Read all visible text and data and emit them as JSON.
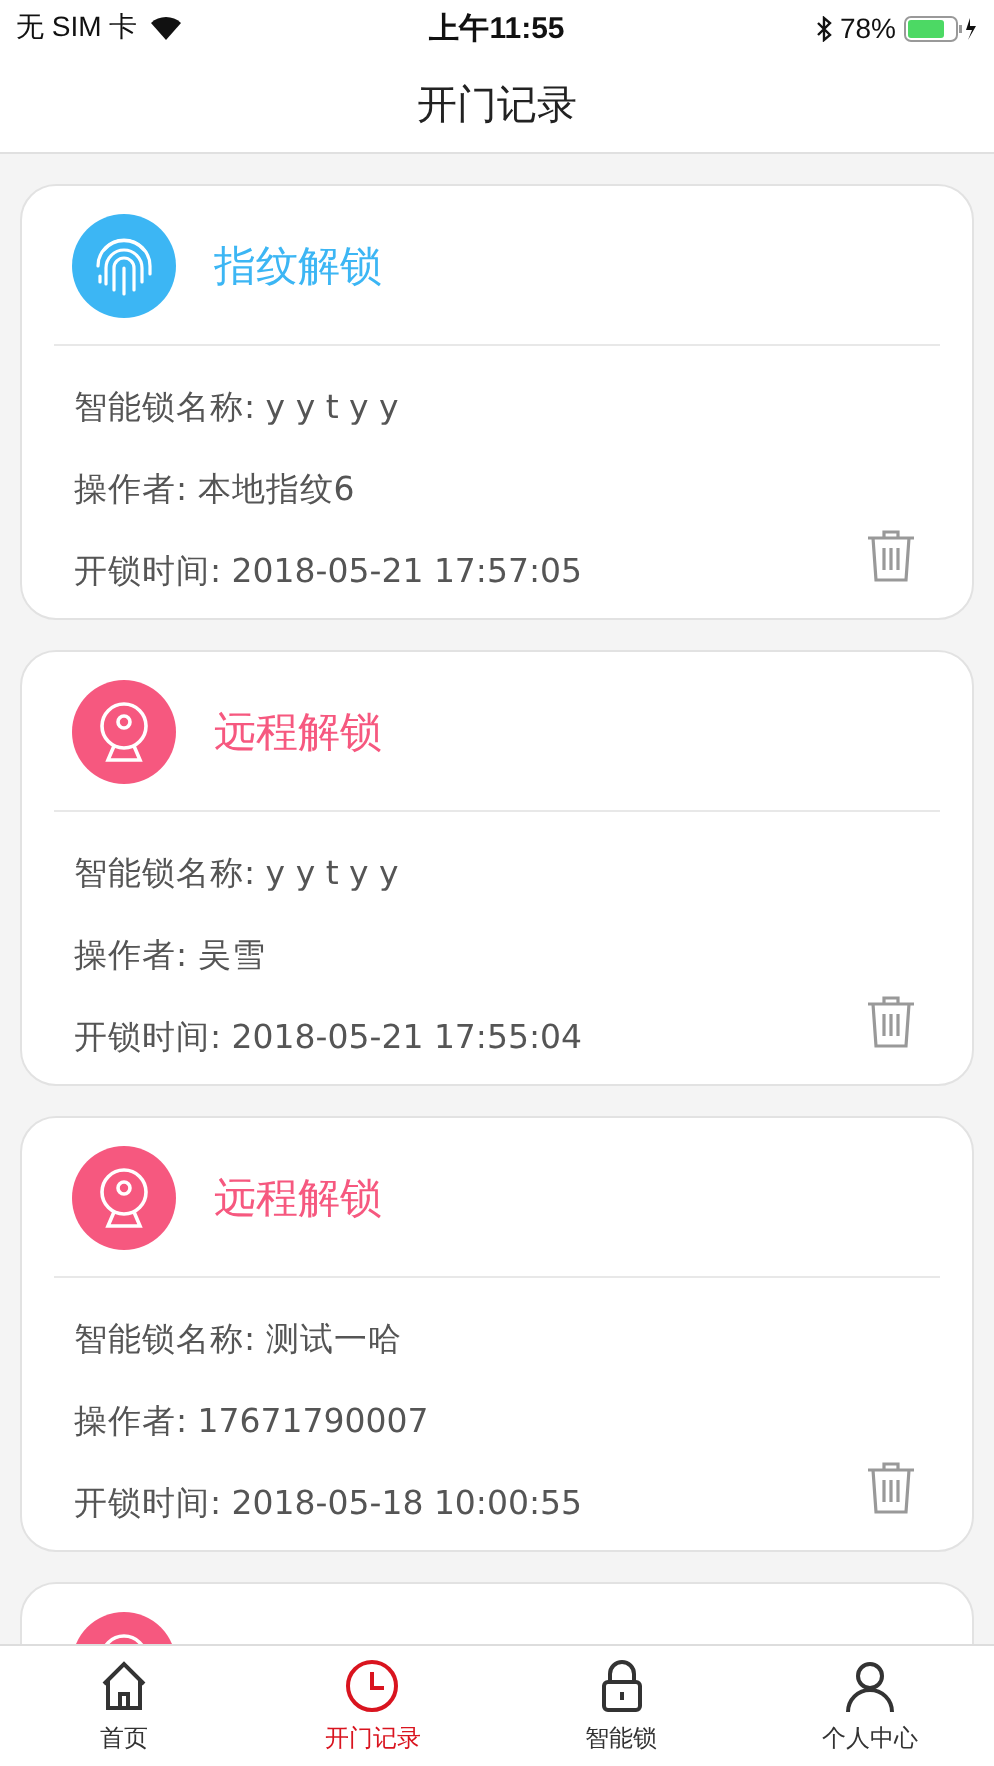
{
  "status_bar": {
    "carrier": "无 SIM 卡",
    "time": "上午11:55",
    "battery": "78%"
  },
  "nav_bar": {
    "title": "开门记录"
  },
  "records": [
    {
      "kind": "fingerprint",
      "title": "指纹解锁",
      "lines": [
        "智能锁名称: y y t y y",
        "操作者: 本地指纹6",
        "开锁时间: 2018-05-21 17:57:05"
      ]
    },
    {
      "kind": "remote",
      "title": "远程解锁",
      "lines": [
        "智能锁名称: y y t y y",
        "操作者: 吴雪",
        "开锁时间: 2018-05-21 17:55:04"
      ]
    },
    {
      "kind": "remote",
      "title": "远程解锁",
      "lines": [
        "智能锁名称: 测试一哈",
        "操作者: 17671790007",
        "开锁时间: 2018-05-18 10:00:55"
      ]
    },
    {
      "kind": "remote"
    }
  ],
  "tab_bar": [
    {
      "kind": "home",
      "label": "首页",
      "selected": false
    },
    {
      "kind": "clock",
      "label": "开门记录",
      "selected": true
    },
    {
      "kind": "lock",
      "label": "智能锁",
      "selected": false
    },
    {
      "kind": "person",
      "label": "个人中心",
      "selected": false
    }
  ]
}
